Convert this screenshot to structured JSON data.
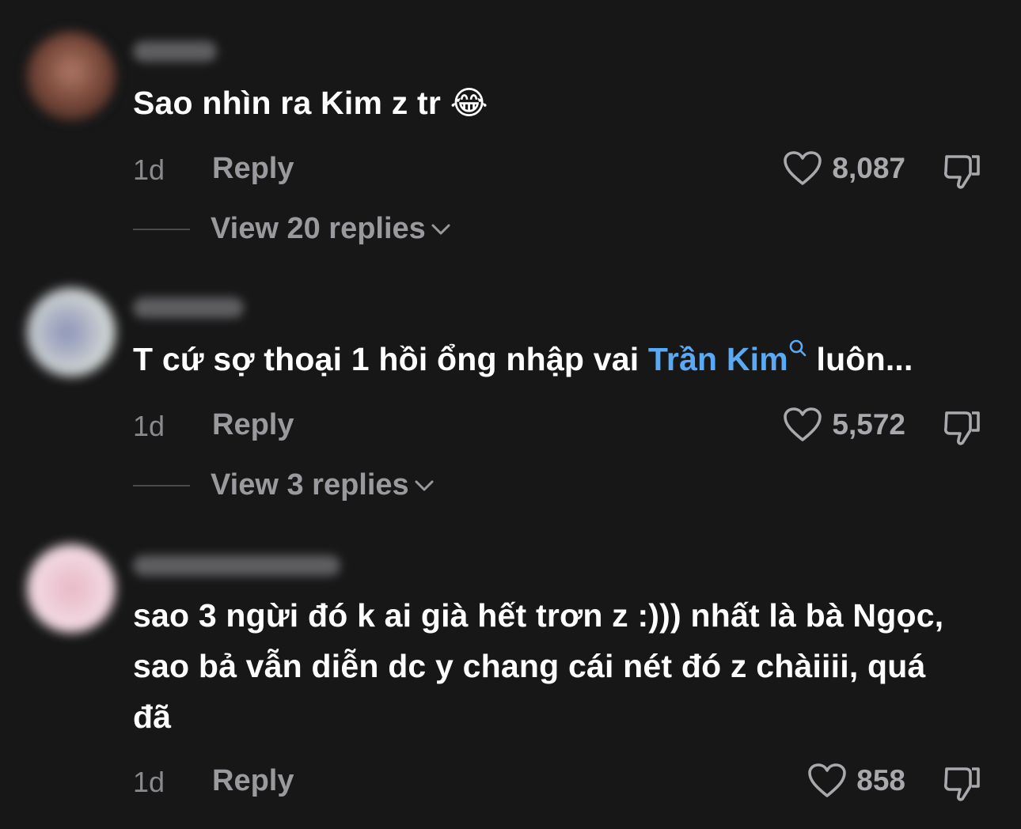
{
  "comments": [
    {
      "text": "Sao nhìn ra Kim z tr 😂",
      "time": "1d",
      "reply_label": "Reply",
      "likes": "8,087",
      "replies_label": "View 20 replies",
      "avatar_colors": [
        "#b07866",
        "#4a2a22"
      ]
    },
    {
      "text_before": "T cứ sợ thoại 1 hồi ổng nhập vai ",
      "mention": "Trần Kim",
      "text_after": " luôn...",
      "time": "1d",
      "reply_label": "Reply",
      "likes": "5,572",
      "replies_label": "View 3 replies",
      "avatar_colors": [
        "#c7cdd2",
        "#8c93b8"
      ]
    },
    {
      "text": "sao 3 ngừi đó k ai già hết trơn z :))) nhất là bà Ngọc, sao bả vẫn diễn dc y chang cái nét đó z chàiiii, quá đã",
      "time": "1d",
      "reply_label": "Reply",
      "likes": "858",
      "avatar_colors": [
        "#f1d6df",
        "#e8b9c7"
      ]
    }
  ],
  "icons": {
    "like": "heart-outline-icon",
    "dislike": "thumbs-down-icon",
    "expand": "chevron-down-icon",
    "mention_search": "search-icon"
  },
  "colors": {
    "background": "#171718",
    "mention": "#5aa9f4",
    "secondary_text": "#9a9a9e"
  }
}
